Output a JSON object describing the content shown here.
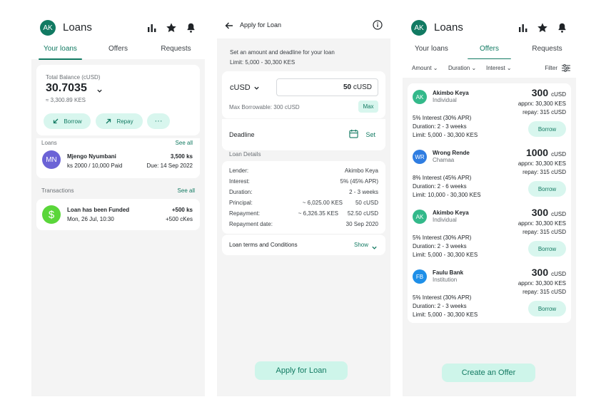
{
  "app": {
    "avatar": "AK",
    "title": "Loans"
  },
  "tabs": [
    "Your loans",
    "Offers",
    "Requests"
  ],
  "balance": {
    "label": "Total Balance (cUSD)",
    "value": "30.7035",
    "kes": "≈ 3,300.89 KES"
  },
  "actions": {
    "borrow": "Borrow",
    "repay": "Repay",
    "more": "···"
  },
  "loans": {
    "title": "Loans",
    "see_all": "See all",
    "item": {
      "avatar": "MN",
      "name": "Mjengo Nyumbani",
      "sub": "ks 2000 / 10,000 Paid",
      "amount": "3,500 ks",
      "due": "Due: 14 Sep 2022"
    }
  },
  "transactions": {
    "title": "Transactions",
    "see_all": "See all",
    "item": {
      "title": "Loan has been Funded",
      "date": "Mon, 26 Jul, 10:30",
      "amount": "+500 ks",
      "amount2": "+500 cKes"
    }
  },
  "apply": {
    "title": "Apply for Loan",
    "intro": "Set an amount and deadline for your loan",
    "limit": "Limit: 5,000 - 30,300 KES",
    "currency": "cUSD",
    "amount": "50",
    "amount_unit": "cUSD",
    "max_borrowable": "Max Borrowable: 300 cUSD",
    "max": "Max",
    "deadline": "Deadline",
    "set": "Set",
    "details_title": "Loan Details",
    "details": [
      {
        "label": "Lender:",
        "value": "Akimbo Keya",
        "value2": ""
      },
      {
        "label": "Interest:",
        "value": "5% (45% APR)",
        "value2": ""
      },
      {
        "label": "Duration:",
        "value": "2 - 3 weeks",
        "value2": ""
      },
      {
        "label": "Principal:",
        "value": "~ 6,025.00 KES",
        "value2": "50 cUSD"
      },
      {
        "label": "Repayment:",
        "value": "~ 6,326.35 KES",
        "value2": "52.50 cUSD"
      },
      {
        "label": "Repayment date:",
        "value": "30 Sep 2020",
        "value2": ""
      }
    ],
    "terms": "Loan terms and Conditions",
    "show": "Show",
    "submit": "Apply for Loan"
  },
  "offers_screen": {
    "filters": [
      "Amount",
      "Duration",
      "Interest"
    ],
    "filter": "Filter",
    "offers": [
      {
        "avatar": "AK",
        "color": "#33b98a",
        "name": "Akimbo Keya",
        "type": "Individual",
        "amount": "300",
        "unit": "cUSD",
        "apprx": "apprx: 30,300 KES",
        "repay": "repay: 315 cUSD",
        "interest": "5% Interest (30% APR)",
        "duration": "Duration: 2 - 3 weeks",
        "limit": "Limit: 5,000 - 30,300 KES",
        "btn": "Borrow"
      },
      {
        "avatar": "WR",
        "color": "#2f7de1",
        "name": "Wrong Rende",
        "type": "Chamaa",
        "amount": "1000",
        "unit": "cUSD",
        "apprx": "apprx: 30,300 KES",
        "repay": "repay: 315 cUSD",
        "interest": "8% Interest (45% APR)",
        "duration": "Duration: 2 - 6 weeks",
        "limit": "Limit: 10,000 - 30,300 KES",
        "btn": "Borrow"
      },
      {
        "avatar": "AK",
        "color": "#33b98a",
        "name": "Akimbo Keya",
        "type": "Individual",
        "amount": "300",
        "unit": "cUSD",
        "apprx": "apprx: 30,300 KES",
        "repay": "repay: 315 cUSD",
        "interest": "5% Interest (30% APR)",
        "duration": "Duration: 2 - 3 weeks",
        "limit": "Limit: 5,000 - 30,300 KES",
        "btn": "Borrow"
      },
      {
        "avatar": "FB",
        "color": "#1e8fe8",
        "name": "Faulu Bank",
        "type": "Institution",
        "amount": "300",
        "unit": "cUSD",
        "apprx": "apprx: 30,300 KES",
        "repay": "repay: 315 cUSD",
        "interest": "5% Interest (30% APR)",
        "duration": "Duration: 2 - 3 weeks",
        "limit": "Limit: 5,000 - 30,300 KES",
        "btn": "Borrow"
      }
    ],
    "create": "Create an Offer"
  },
  "colors": {
    "primary": "#117a62",
    "mint": "#d8f6ee",
    "purple": "#6b63d6",
    "funded": "#5ad63a"
  }
}
